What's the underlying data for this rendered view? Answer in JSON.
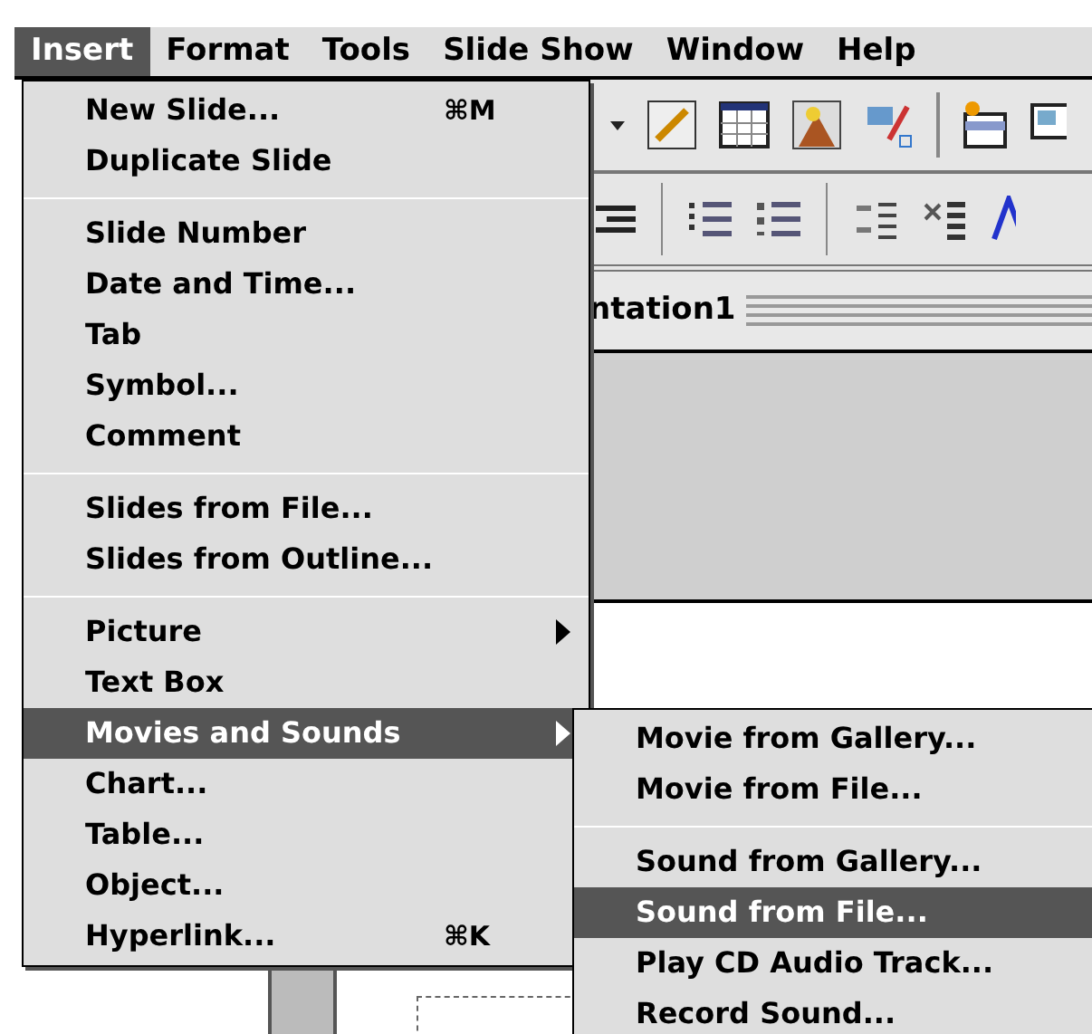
{
  "menu_bar": [
    {
      "label": "Insert",
      "selected": true
    },
    {
      "label": "Format",
      "selected": false
    },
    {
      "label": "Tools",
      "selected": false
    },
    {
      "label": "Slide Show",
      "selected": false
    },
    {
      "label": "Window",
      "selected": false
    },
    {
      "label": "Help",
      "selected": false
    }
  ],
  "document": {
    "title": "ntation1"
  },
  "insert_menu": [
    {
      "kind": "item",
      "label": "New Slide...",
      "shortcut": "⌘M",
      "selected": false
    },
    {
      "kind": "item",
      "label": "Duplicate Slide",
      "selected": false
    },
    {
      "kind": "separator"
    },
    {
      "kind": "item",
      "label": "Slide Number",
      "selected": false
    },
    {
      "kind": "item",
      "label": "Date and Time...",
      "selected": false
    },
    {
      "kind": "item",
      "label": "Tab",
      "selected": false
    },
    {
      "kind": "item",
      "label": "Symbol...",
      "selected": false
    },
    {
      "kind": "item",
      "label": "Comment",
      "selected": false
    },
    {
      "kind": "separator"
    },
    {
      "kind": "item",
      "label": "Slides from File...",
      "selected": false
    },
    {
      "kind": "item",
      "label": "Slides from Outline...",
      "selected": false
    },
    {
      "kind": "separator"
    },
    {
      "kind": "submenu",
      "label": "Picture",
      "selected": false
    },
    {
      "kind": "item",
      "label": "Text Box",
      "selected": false
    },
    {
      "kind": "submenu",
      "label": "Movies and Sounds",
      "selected": true
    },
    {
      "kind": "item",
      "label": "Chart...",
      "selected": false
    },
    {
      "kind": "item",
      "label": "Table...",
      "selected": false
    },
    {
      "kind": "item",
      "label": "Object...",
      "selected": false
    },
    {
      "kind": "item",
      "label": "Hyperlink...",
      "shortcut": "⌘K",
      "selected": false
    }
  ],
  "submenu": [
    {
      "kind": "item",
      "label": "Movie from Gallery...",
      "selected": false
    },
    {
      "kind": "item",
      "label": "Movie from File...",
      "selected": false
    },
    {
      "kind": "separator"
    },
    {
      "kind": "item",
      "label": "Sound from Gallery...",
      "selected": false
    },
    {
      "kind": "item",
      "label": "Sound from File...",
      "selected": true
    },
    {
      "kind": "item",
      "label": "Play CD Audio Track...",
      "selected": false
    },
    {
      "kind": "item",
      "label": "Record Sound...",
      "selected": false
    }
  ]
}
